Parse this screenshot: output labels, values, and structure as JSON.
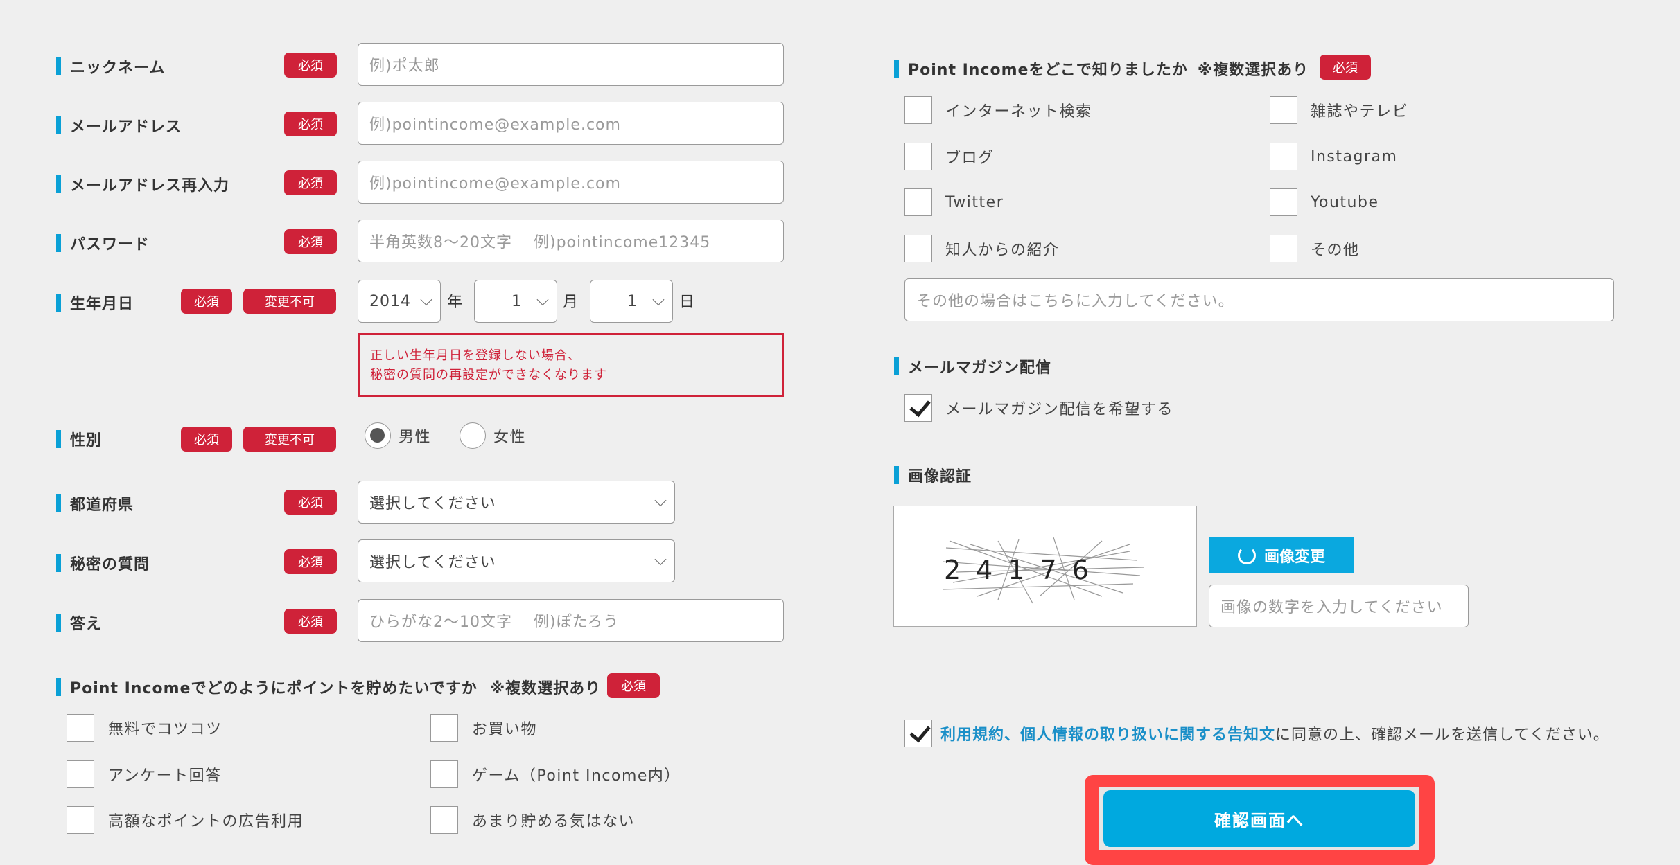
{
  "required_label": "必須",
  "nochange_label": "変更不可",
  "left": {
    "nickname": {
      "label": "ニックネーム",
      "placeholder": "例)ポ太郎"
    },
    "email": {
      "label": "メールアドレス",
      "placeholder": "例)pointincome@example.com"
    },
    "email_confirm": {
      "label": "メールアドレス再入力",
      "placeholder": "例)pointincome@example.com"
    },
    "password": {
      "label": "パスワード",
      "placeholder": "半角英数8～20文字　 例)pointincome12345"
    },
    "birthdate": {
      "label": "生年月日",
      "year": "2014",
      "year_unit": "年",
      "month": "1",
      "month_unit": "月",
      "day": "1",
      "day_unit": "日",
      "warning_line1": "正しい生年月日を登録しない場合、",
      "warning_line2": "秘密の質問の再設定ができなくなります"
    },
    "gender": {
      "label": "性別",
      "options": [
        "男性",
        "女性"
      ],
      "selected": "男性"
    },
    "prefecture": {
      "label": "都道府県",
      "value": "選択してください"
    },
    "secret_question": {
      "label": "秘密の質問",
      "value": "選択してください"
    },
    "answer": {
      "label": "答え",
      "placeholder": "ひらがな2～10文字　 例)ぽたろう"
    },
    "savings": {
      "label": "Point Incomeでどのようにポイントを貯めたいですか",
      "note": "※複数選択あり",
      "options": [
        "無料でコツコツ",
        "お買い物",
        "アンケート回答",
        "ゲーム（Point Income内）",
        "高額なポイントの広告利用",
        "あまり貯める気はない"
      ]
    }
  },
  "right": {
    "source": {
      "label": "Point Incomeをどこで知りましたか",
      "note": "※複数選択あり",
      "options": [
        "インターネット検索",
        "雑誌やテレビ",
        "ブログ",
        "Instagram",
        "Twitter",
        "Youtube",
        "知人からの紹介",
        "その他"
      ],
      "other_placeholder": "その他の場合はこちらに入力してください。"
    },
    "newsletter": {
      "label": "メールマガジン配信",
      "option": "メールマガジン配信を希望する",
      "checked": true
    },
    "captcha": {
      "label": "画像認証",
      "image_digits": "24176",
      "refresh_label": "画像変更",
      "input_placeholder": "画像の数字を入力してください"
    },
    "terms": {
      "link_text": "利用規約、個人情報の取り扱いに関する告知文",
      "text": "に同意の上、確認メールを送信してください。",
      "checked": true
    },
    "submit_label": "確認画面へ"
  }
}
